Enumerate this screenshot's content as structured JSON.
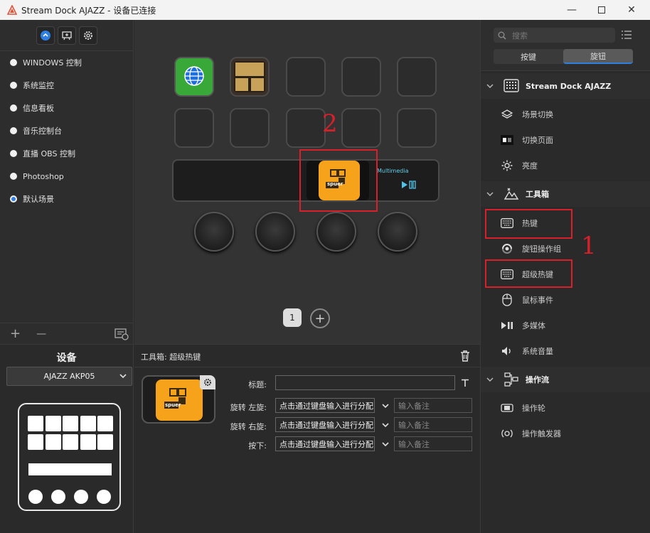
{
  "window": {
    "title": "Stream Dock AJAZZ - 设备已连接"
  },
  "left": {
    "scenes": [
      {
        "label": "WINDOWS 控制",
        "selected": false
      },
      {
        "label": "系统监控",
        "selected": false
      },
      {
        "label": "信息看板",
        "selected": false
      },
      {
        "label": "音乐控制台",
        "selected": false
      },
      {
        "label": "直播 OBS 控制",
        "selected": false
      },
      {
        "label": "Photoshop",
        "selected": false
      },
      {
        "label": "默认场景",
        "selected": true
      }
    ],
    "add_symbol": "+",
    "remove_symbol": "—"
  },
  "device": {
    "header": "设备",
    "selected_device": "AJAZZ AKP05"
  },
  "center": {
    "strip_label": "Multimedia",
    "spuer_text": "spuer",
    "page_number": "1",
    "annotation_2": "2"
  },
  "props": {
    "header": "工具箱: 超级热键",
    "title_label": "标题:",
    "rotate_left_label": "旋转 左旋:",
    "rotate_right_label": "旋转 右旋:",
    "press_label": "按下:",
    "assign_text": "点击通过键盘输入进行分配",
    "note_placeholder": "输入备注",
    "spuer_text": "spuer"
  },
  "right": {
    "search_placeholder": "搜索",
    "tabs": [
      {
        "label": "按键",
        "active": false
      },
      {
        "label": "旋钮",
        "active": true
      }
    ],
    "cat_device": "Stream Dock AJAZZ",
    "device_items": [
      "场景切换",
      "切换页面",
      "亮度"
    ],
    "cat_toolbox": "工具箱",
    "toolbox_items": [
      "热键",
      "旋钮操作组",
      "超级热键",
      "鼠标事件",
      "多媒体",
      "系统音量"
    ],
    "cat_flow": "操作流",
    "flow_items": [
      "操作轮",
      "操作触发器"
    ],
    "annotation_1": "1"
  },
  "colors": {
    "accent": "#2f7fe0",
    "annotation": "#d8202a",
    "icon_orange": "#f7a21b"
  }
}
